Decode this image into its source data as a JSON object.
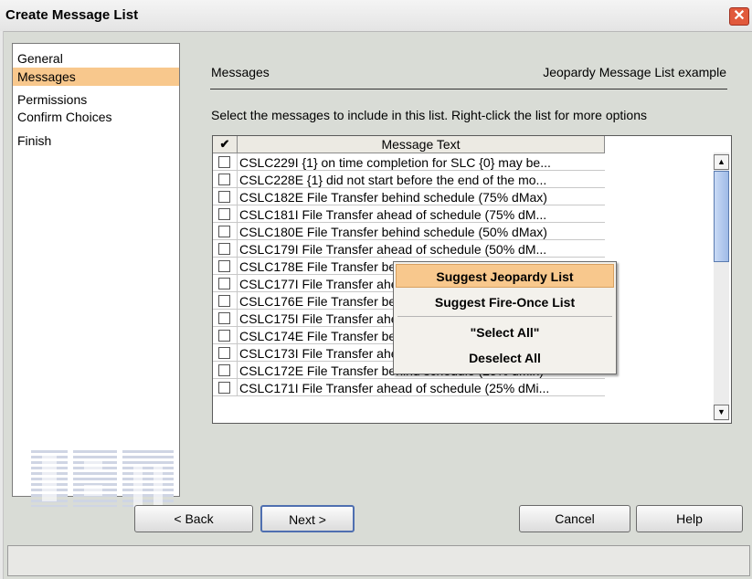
{
  "window": {
    "title": "Create Message List",
    "close_glyph": "✕"
  },
  "nav": {
    "items": [
      "General",
      "Messages",
      "Permissions",
      "Confirm Choices",
      "Finish"
    ],
    "selected": "Messages"
  },
  "logo_text": "IBM",
  "section": {
    "title": "Messages",
    "subtitle": "Jeopardy Message List example"
  },
  "instruction": "Select the messages to include in this list. Right-click the list for more options",
  "table": {
    "headers": {
      "check": "✔",
      "text": "Message Text"
    },
    "rows": [
      "CSLC229I {1} on time completion for SLC {0} may be...",
      "CSLC228E {1} did not start before the end of the mo...",
      "CSLC182E File Transfer behind schedule (75% dMax)",
      "CSLC181I File Transfer ahead of schedule (75% dM...",
      "CSLC180E File Transfer behind schedule (50% dMax)",
      "CSLC179I File Transfer ahead of schedule (50% dM...",
      "CSLC178E File Transfer behind schedule (50% dMin)",
      "CSLC177I File Transfer ahead of schedule (50% dMi...",
      "CSLC176E File Transfer behind schedule (25% dMax)",
      "CSLC175I File Transfer ahead of schedule (25% dM...",
      "CSLC174E File Transfer behind schedule (50% dMin)",
      "CSLC173I File Transfer ahead of schedule (50% dMi...",
      "CSLC172E File Transfer behind schedule (25% dMin)",
      "CSLC171I File Transfer ahead of schedule (25% dMi..."
    ]
  },
  "context_menu": {
    "items": [
      "Suggest Jeopardy List",
      "Suggest Fire-Once List",
      "\"Select All\"",
      "Deselect All"
    ],
    "highlighted": "Suggest Jeopardy List"
  },
  "buttons": {
    "back": "< Back",
    "next": "Next >",
    "cancel": "Cancel",
    "help": "Help"
  },
  "colors": {
    "selection": "#f8c88d",
    "close_button": "#e1593c",
    "scroll_thumb": "#9fbbe7"
  },
  "icons": {
    "close": "close-icon",
    "scroll_up": "scroll-up-icon",
    "scroll_down": "scroll-down-icon"
  }
}
